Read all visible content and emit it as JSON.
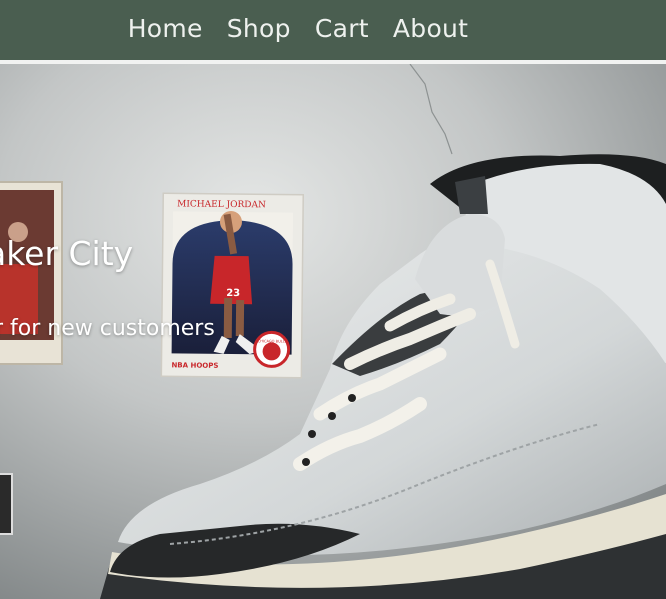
{
  "nav": {
    "links": [
      {
        "label": "Home"
      },
      {
        "label": "Shop"
      },
      {
        "label": "Cart"
      },
      {
        "label": "About"
      }
    ]
  },
  "hero": {
    "title": "aker City",
    "subtitle": "r for new customers",
    "poster_name": "MICHAEL JORDAN",
    "poster_jersey": "23",
    "poster_brand": "NBA HOOPS",
    "poster_team": "CHICAGO BULLS"
  },
  "colors": {
    "nav_bg": "#4a5e50",
    "nav_text": "#eef1ee",
    "hero_text": "#ffffff"
  }
}
